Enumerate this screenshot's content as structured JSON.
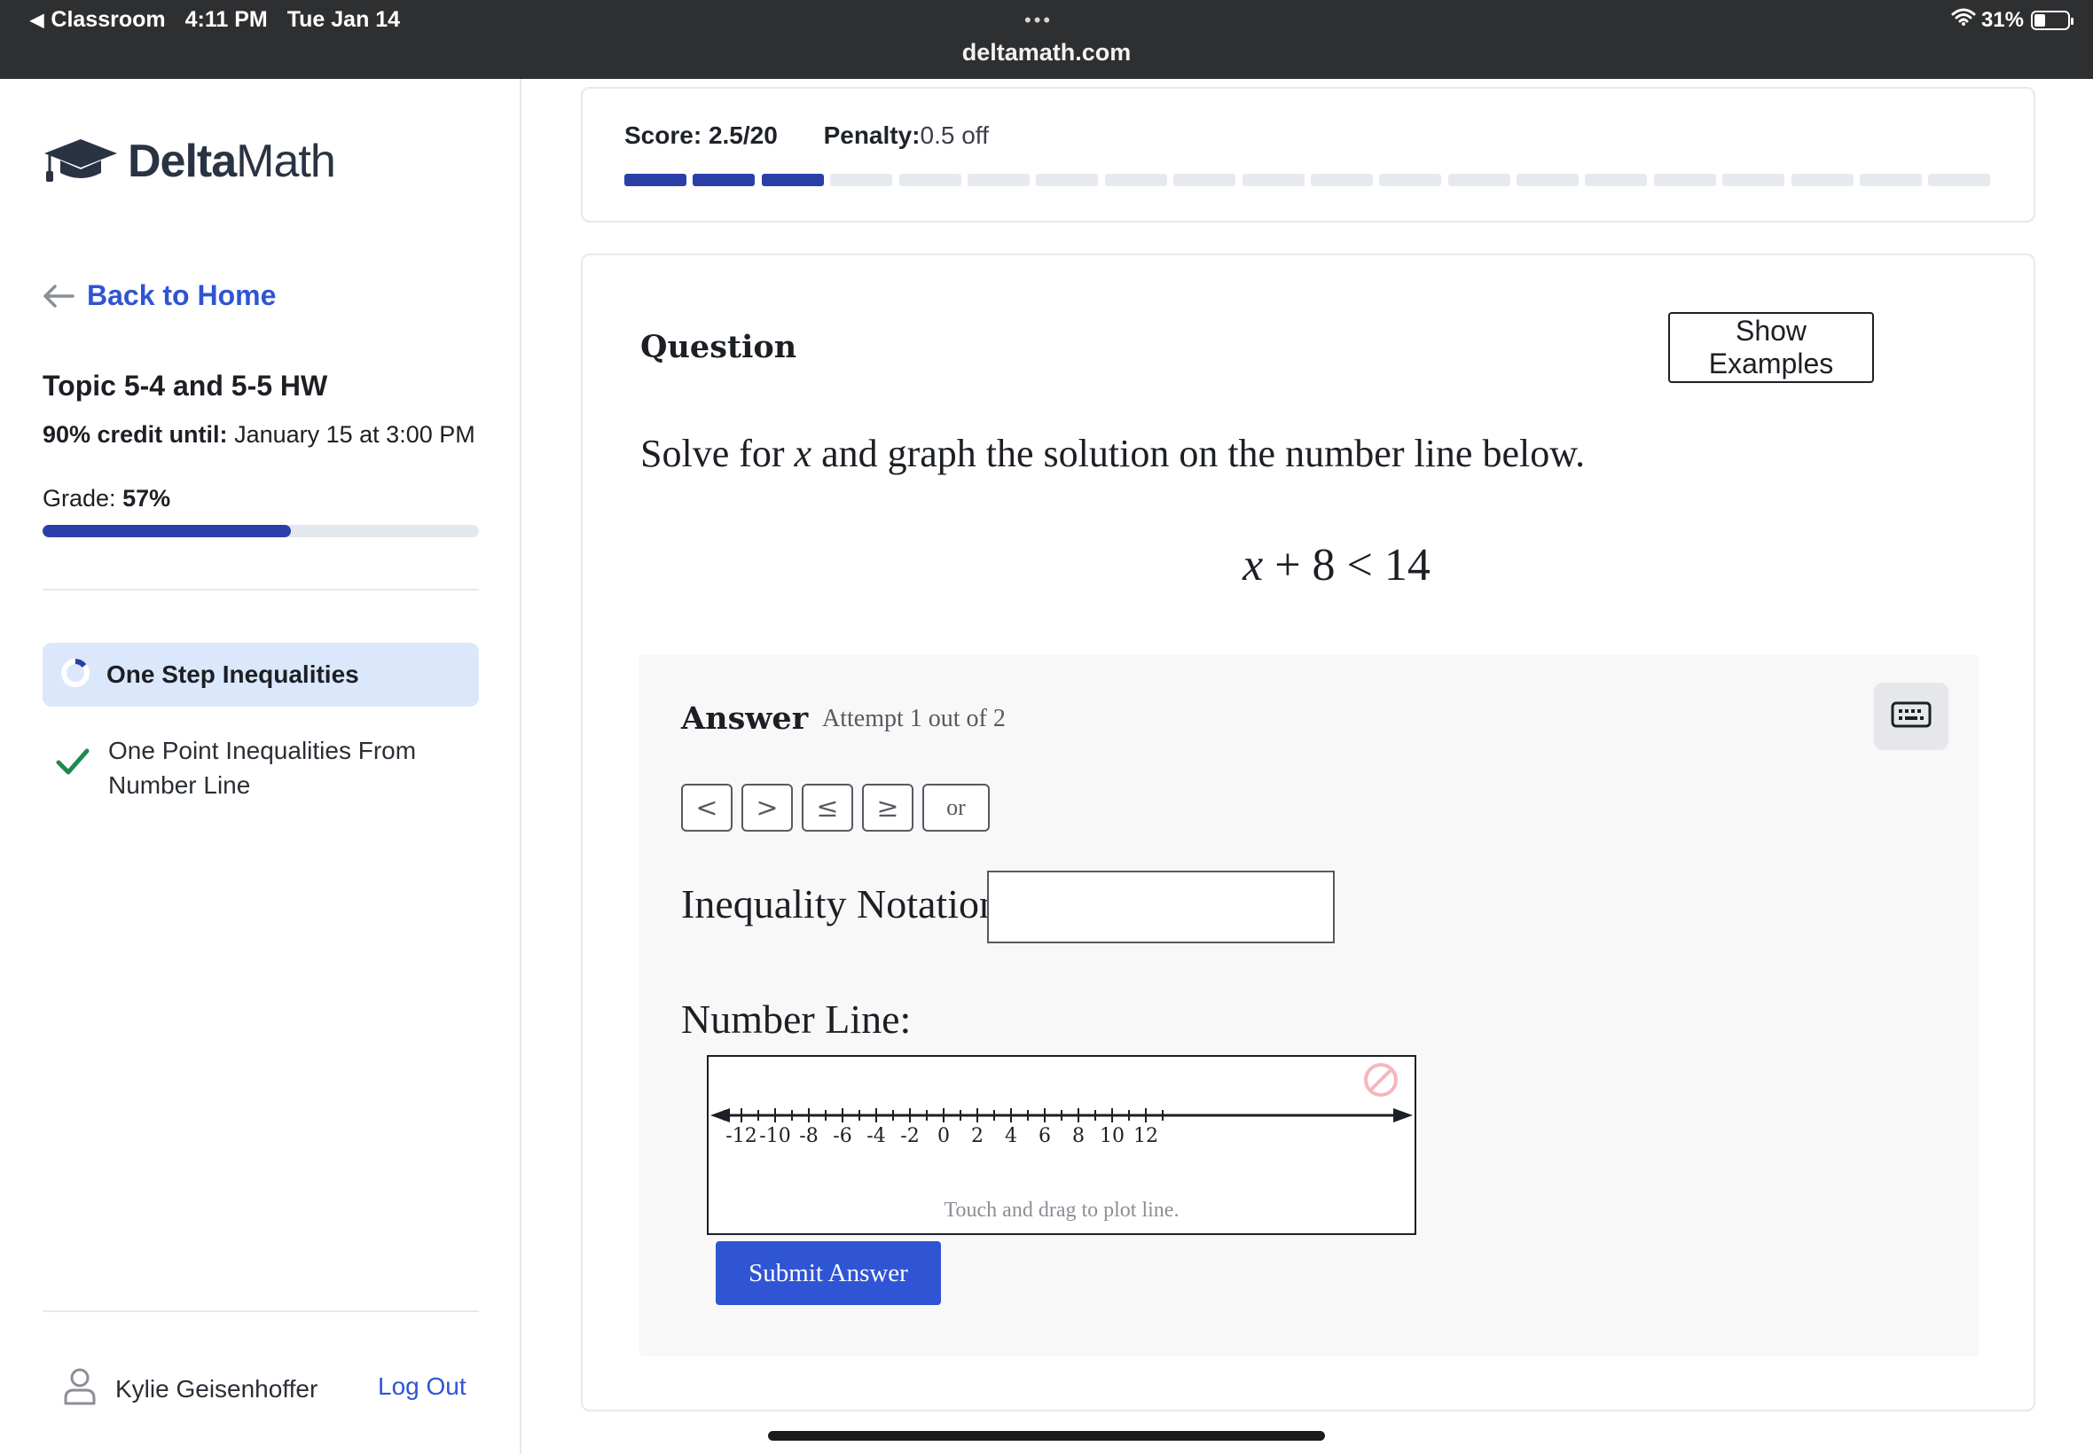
{
  "status_bar": {
    "back_app": "Classroom",
    "time": "4:11 PM",
    "date": "Tue Jan 14",
    "url": "deltamath.com",
    "battery": "31%",
    "more_dots": "•••"
  },
  "sidebar": {
    "logo_bold": "Delta",
    "logo_light": "Math",
    "back_link": "Back to Home",
    "assignment_title": "Topic 5-4 and 5-5 HW",
    "credit_label": "90% credit until:",
    "credit_value": "January 15 at 3:00 PM",
    "grade_label": "Grade:",
    "grade_value": "57%",
    "grade_fraction": 0.57,
    "skills": [
      {
        "label": "One Step Inequalities",
        "state": "in-progress"
      },
      {
        "label": "One Point Inequalities From Number Line",
        "state": "complete"
      }
    ],
    "user_name": "Kylie Geisenhoffer",
    "logout": "Log Out"
  },
  "score": {
    "score_label": "Score:",
    "score_value": "2.5/20",
    "penalty_label": "Penalty:",
    "penalty_value": "0.5 off",
    "segments_total": 20,
    "segments_filled": 3
  },
  "question": {
    "label": "Question",
    "show_examples": "Show Examples",
    "prompt_before": "Solve for ",
    "prompt_var": "x",
    "prompt_after": " and graph the solution on the number line below.",
    "eq_var": "x",
    "eq_rest": " + 8 < 14"
  },
  "answer": {
    "label": "Answer",
    "attempt": "Attempt 1 out of 2",
    "symbols": [
      "<",
      ">",
      "≤",
      "≥",
      "or"
    ],
    "inequality_label": "Inequality Notation:",
    "inequality_value": "",
    "number_line_label": "Number Line:",
    "number_line_hint": "Touch and drag to plot line.",
    "tick_labels": [
      "-12",
      "-10",
      "-8",
      "-6",
      "-4",
      "-2",
      "0",
      "2",
      "4",
      "6",
      "8",
      "10",
      "12"
    ],
    "submit": "Submit Answer"
  },
  "colors": {
    "accent": "#2f55d4",
    "progress": "#2a3fa8",
    "check": "#1e8a4c",
    "topbar": "#2e2f31",
    "active_skill_bg": "#dbe8fb"
  },
  "icons": [
    "back-arrow-icon",
    "graduation-cap-icon",
    "progress-ring-icon",
    "check-icon",
    "user-icon",
    "keyboard-icon",
    "clear-icon",
    "wifi-icon",
    "battery-icon"
  ]
}
